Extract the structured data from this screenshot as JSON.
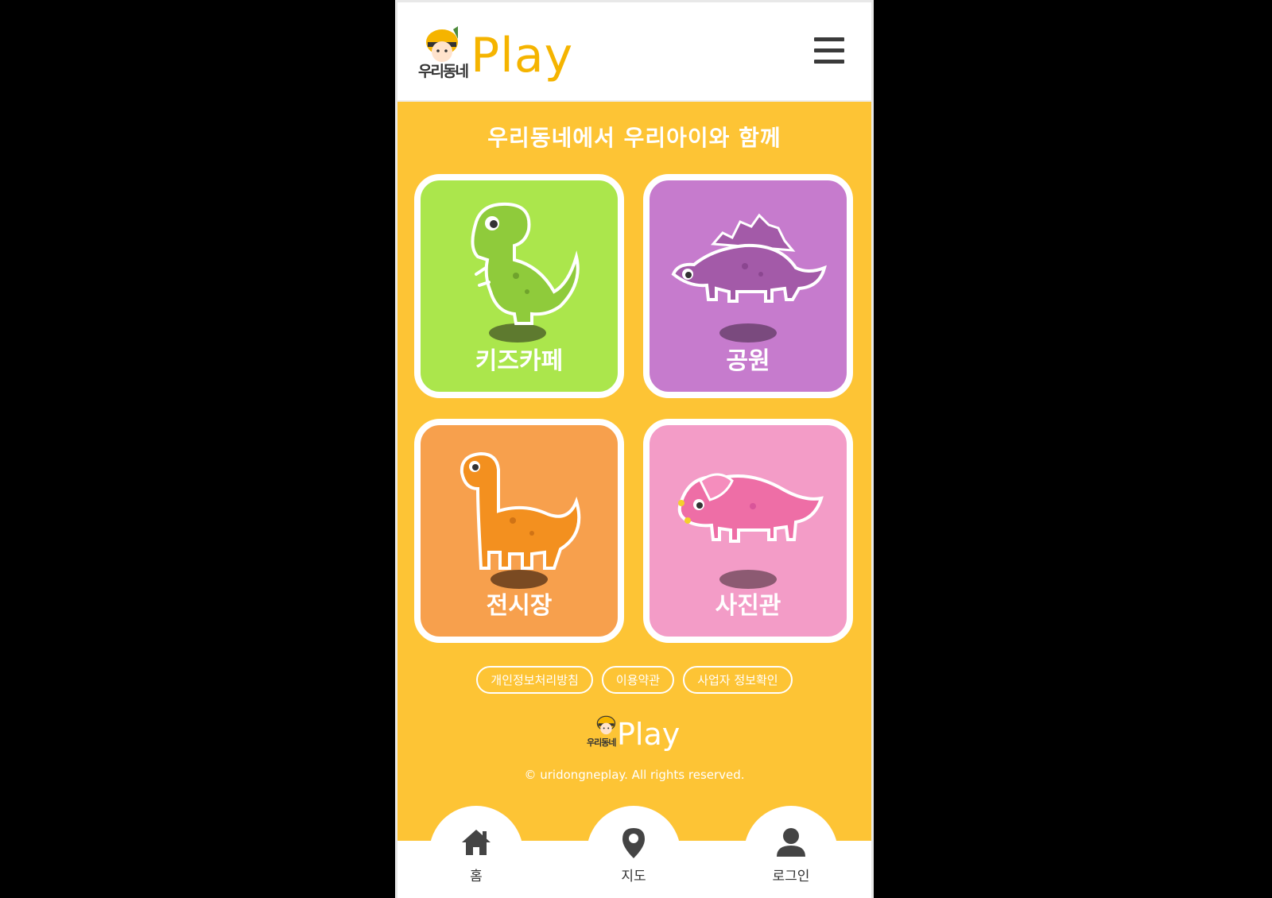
{
  "header": {
    "brand_small": "우리동네",
    "brand_play": "Play",
    "menu_icon": "hamburger-menu-icon"
  },
  "tagline": "우리동네에서 우리아이와 함께",
  "categories": [
    {
      "label": "키즈카페",
      "color": "#abe64c",
      "icon": "t-rex-dinosaur"
    },
    {
      "label": "공원",
      "color": "#c67bcd",
      "icon": "stegosaurus-dinosaur"
    },
    {
      "label": "전시장",
      "color": "#f7a04d",
      "icon": "brachiosaurus-dinosaur"
    },
    {
      "label": "사진관",
      "color": "#f39cc7",
      "icon": "triceratops-dinosaur"
    }
  ],
  "footer": {
    "links": [
      "개인정보처리방침",
      "이용약관",
      "사업자 정보확인"
    ],
    "brand_small": "우리동네",
    "brand_play": "Play",
    "copyright": "© uridongneplay. All rights reserved."
  },
  "nav": [
    {
      "label": "홈",
      "icon": "home-icon"
    },
    {
      "label": "지도",
      "icon": "map-pin-icon"
    },
    {
      "label": "로그인",
      "icon": "user-icon"
    }
  ],
  "colors": {
    "accent": "#fdc435",
    "brand": "#f5b400"
  }
}
